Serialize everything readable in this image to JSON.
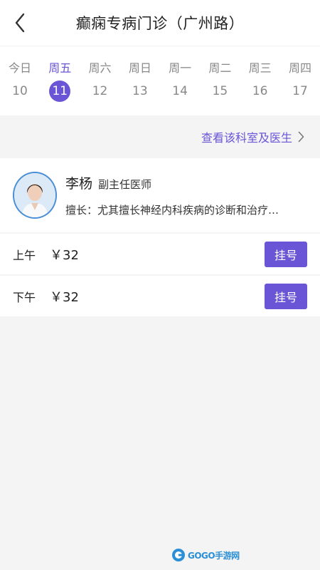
{
  "header": {
    "title": "癫痫专病门诊（广州路）",
    "back_icon": "chevron-left-icon"
  },
  "dates": [
    {
      "name": "今日",
      "num": "10",
      "selected": false
    },
    {
      "name": "周五",
      "num": "11",
      "selected": true
    },
    {
      "name": "周六",
      "num": "12",
      "selected": false
    },
    {
      "name": "周日",
      "num": "13",
      "selected": false
    },
    {
      "name": "周一",
      "num": "14",
      "selected": false
    },
    {
      "name": "周二",
      "num": "15",
      "selected": false
    },
    {
      "name": "周三",
      "num": "16",
      "selected": false
    },
    {
      "name": "周四",
      "num": "17",
      "selected": false
    }
  ],
  "dept_link": {
    "label": "查看该科室及医生",
    "icon": "chevron-right-icon"
  },
  "doctor": {
    "name": "李杨",
    "title": "副主任医师",
    "specialty": "擅长：尤其擅长神经内科疾病的诊断和治疗…"
  },
  "slots": [
    {
      "period": "上午",
      "price": "￥32",
      "button": "挂号"
    },
    {
      "period": "下午",
      "price": "￥32",
      "button": "挂号"
    }
  ],
  "watermark": {
    "text": "GOGO手游网"
  },
  "colors": {
    "accent": "#6a55d6",
    "background": "#f4f4f4"
  }
}
